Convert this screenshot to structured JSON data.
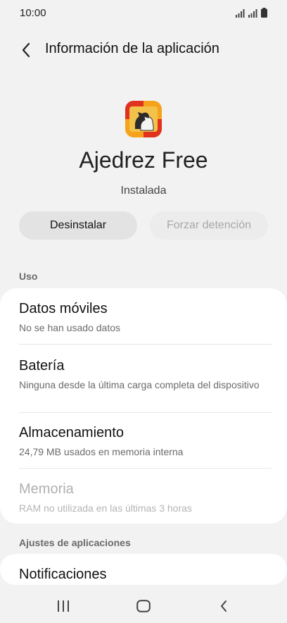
{
  "status_bar": {
    "time": "10:00"
  },
  "header": {
    "title": "Información de la aplicación"
  },
  "app": {
    "name": "Ajedrez Free",
    "status": "Instalada"
  },
  "buttons": {
    "uninstall": "Desinstalar",
    "force_stop": "Forzar detención"
  },
  "sections": {
    "usage": "Uso",
    "app_settings": "Ajustes de aplicaciones"
  },
  "usage_items": [
    {
      "title": "Datos móviles",
      "subtitle": "No se han usado datos"
    },
    {
      "title": "Batería",
      "subtitle": "Ninguna desde la última carga completa del dispositivo"
    },
    {
      "title": "Almacenamiento",
      "subtitle": "24,79 MB usados en memoria interna"
    },
    {
      "title": "Memoria",
      "subtitle": "RAM no utilizada en las últimas 3 horas"
    }
  ],
  "settings_items": [
    {
      "title": "Notificaciones"
    }
  ],
  "colors": {
    "background": "#f2f2f2",
    "card": "#ffffff",
    "icon_orange": "#f6a21c",
    "icon_red": "#e0321f"
  },
  "icons": {
    "back": "chevron-left-icon",
    "recents": "recents-icon",
    "home": "home-icon",
    "nav_back": "nav-back-icon"
  }
}
